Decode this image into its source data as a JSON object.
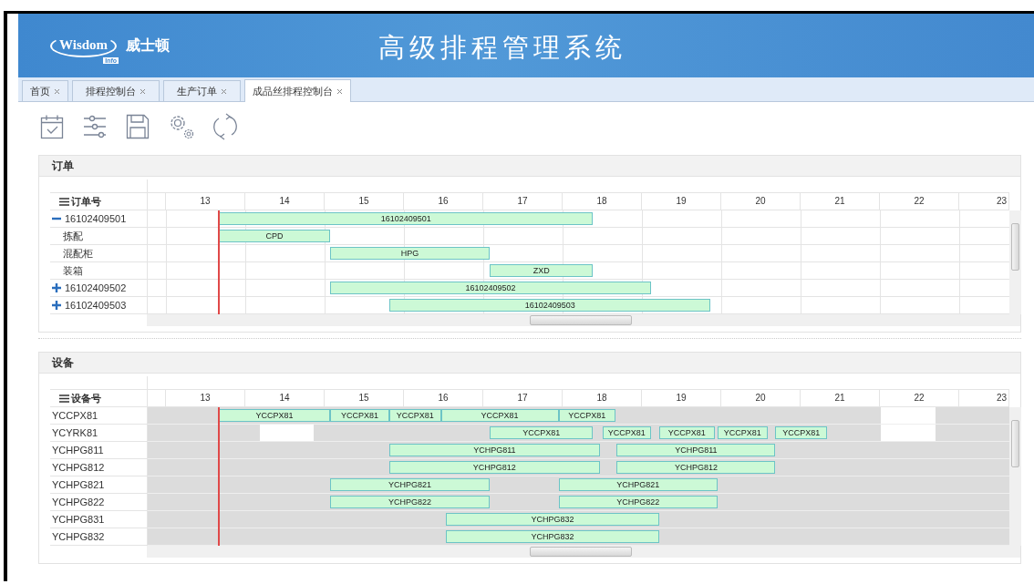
{
  "header": {
    "logo": {
      "wordmark": "Wisdom",
      "badge": "Info",
      "name": "威士顿"
    },
    "title": "高级排程管理系统"
  },
  "tabs": [
    {
      "label": "首页",
      "selected": false
    },
    {
      "label": "排程控制台",
      "selected": false
    },
    {
      "label": "生产订单",
      "selected": false
    },
    {
      "label": "成品丝排程控制台",
      "selected": true
    }
  ],
  "toolbar": [
    {
      "kind": "calendar"
    },
    {
      "kind": "sliders"
    },
    {
      "kind": "save"
    },
    {
      "kind": "gears"
    },
    {
      "kind": "refresh"
    }
  ],
  "orders": {
    "title": "订单",
    "column": "订单号",
    "hours": [
      "13",
      "14",
      "15",
      "16",
      "17",
      "18",
      "19",
      "20",
      "21",
      "22",
      "23"
    ],
    "rows": [
      {
        "id": "16102409501",
        "expanded": true,
        "bar": "16102409501",
        "children": [
          {
            "name": "拣配",
            "bar": "CPD"
          },
          {
            "name": "混配柜",
            "bar": "HPG"
          },
          {
            "name": "装箱",
            "bar": "ZXD"
          }
        ]
      },
      {
        "id": "16102409502",
        "expanded": false,
        "bar": "16102409502"
      },
      {
        "id": "16102409503",
        "expanded": false,
        "bar": "16102409503"
      }
    ]
  },
  "equipment": {
    "title": "设备",
    "column": "设备号",
    "hours": [
      "13",
      "14",
      "15",
      "16",
      "17",
      "18",
      "19",
      "20",
      "21",
      "22",
      "23"
    ],
    "rows": [
      {
        "name": "YCCPX81",
        "bars": [
          "YCCPX81",
          "YCCPX81",
          "YCCPX81",
          "YCCPX81",
          "YCCPX81"
        ]
      },
      {
        "name": "YCYRK81",
        "bars": [
          "YCCPX81",
          "YCCPX81",
          "YCCPX81",
          "YCCPX81",
          "YCCPX81"
        ]
      },
      {
        "name": "YCHPG811",
        "bars": [
          "YCHPG811",
          "YCHPG811"
        ]
      },
      {
        "name": "YCHPG812",
        "bars": [
          "YCHPG812",
          "YCHPG812"
        ]
      },
      {
        "name": "YCHPG821",
        "bars": [
          "YCHPG821",
          "YCHPG821"
        ]
      },
      {
        "name": "YCHPG822",
        "bars": [
          "YCHPG822",
          "YCHPG822"
        ]
      },
      {
        "name": "YCHPG831",
        "bars": [
          "YCHPG832"
        ]
      },
      {
        "name": "YCHPG832",
        "bars": [
          "YCHPG832"
        ]
      }
    ]
  }
}
